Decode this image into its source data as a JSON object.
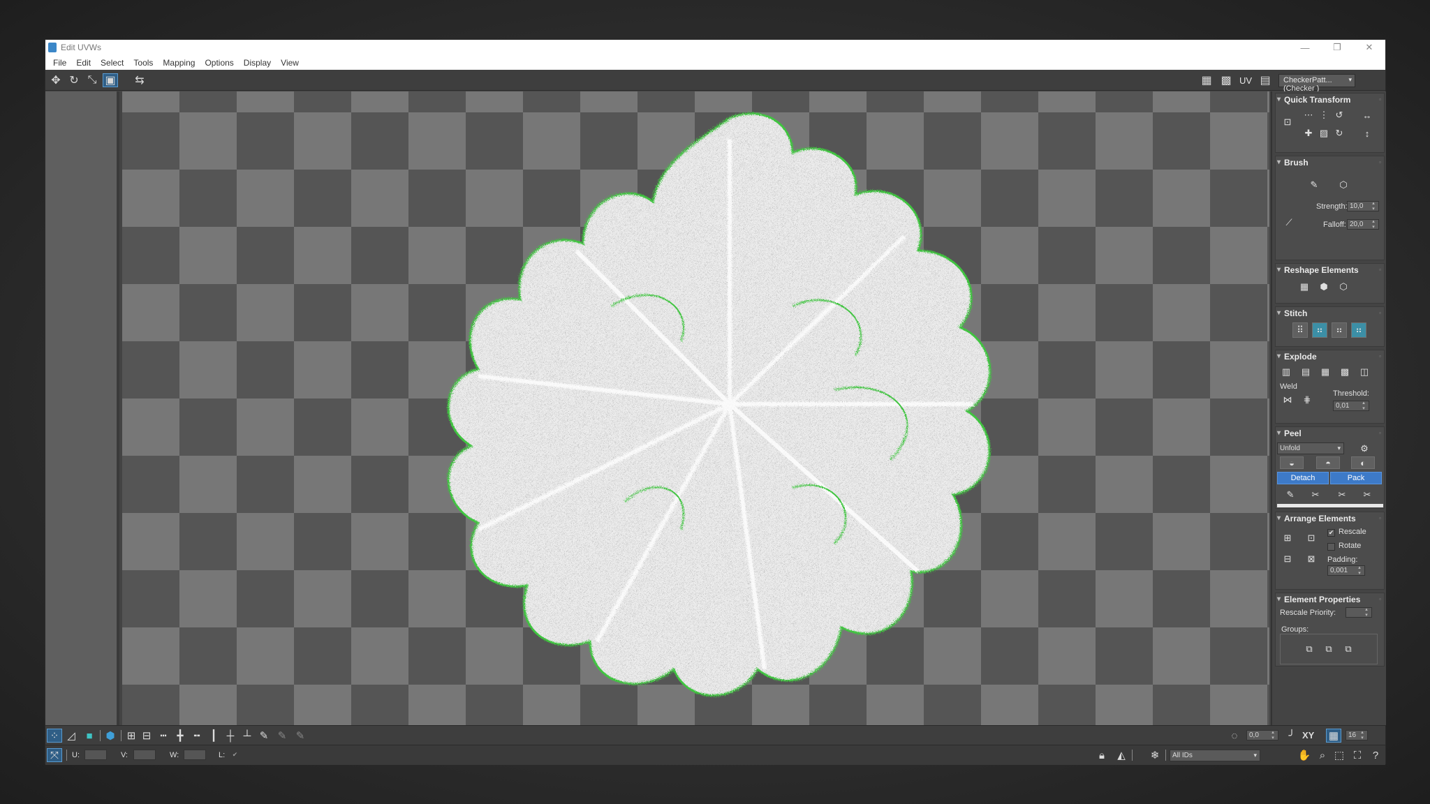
{
  "window": {
    "title": "Edit UVWs",
    "controls": [
      "—",
      "❐",
      "✕"
    ]
  },
  "menu": [
    "File",
    "Edit",
    "Select",
    "Tools",
    "Mapping",
    "Options",
    "Display",
    "View"
  ],
  "toolbar": {
    "uv_label": "UV",
    "texture_dropdown": "CheckerPatt...(Checker )"
  },
  "panels": {
    "quick_transform": {
      "title": "Quick Transform"
    },
    "brush": {
      "title": "Brush",
      "strength_label": "Strength:",
      "strength": "10,0",
      "falloff_label": "Falloff:",
      "falloff": "20,0"
    },
    "reshape": {
      "title": "Reshape Elements"
    },
    "stitch": {
      "title": "Stitch"
    },
    "explode": {
      "title": "Explode",
      "weld_label": "Weld",
      "threshold_label": "Threshold:",
      "threshold": "0,01"
    },
    "peel": {
      "title": "Peel",
      "mode": "Unfold",
      "detach_label": "Detach",
      "pack_label": "Pack"
    },
    "arrange": {
      "title": "Arrange Elements",
      "rescale_label": "Rescale",
      "rotate_label": "Rotate",
      "padding_label": "Padding:",
      "padding": "0,001"
    },
    "element_props": {
      "title": "Element Properties",
      "rescale_priority_label": "Rescale Priority:",
      "groups_label": "Groups:"
    }
  },
  "bottom": {
    "rotation_value": "0,0",
    "axis_label": "XY",
    "grid_value": "16",
    "u_label": "U:",
    "v_label": "V:",
    "w_label": "W:",
    "l_label": "L:",
    "id_filter": "All IDs"
  },
  "colors": {
    "accent_blue": "#3d7ac8",
    "uv_edge_green": "#3fc43f",
    "checker_light": "#777777",
    "checker_dark": "#555555"
  }
}
